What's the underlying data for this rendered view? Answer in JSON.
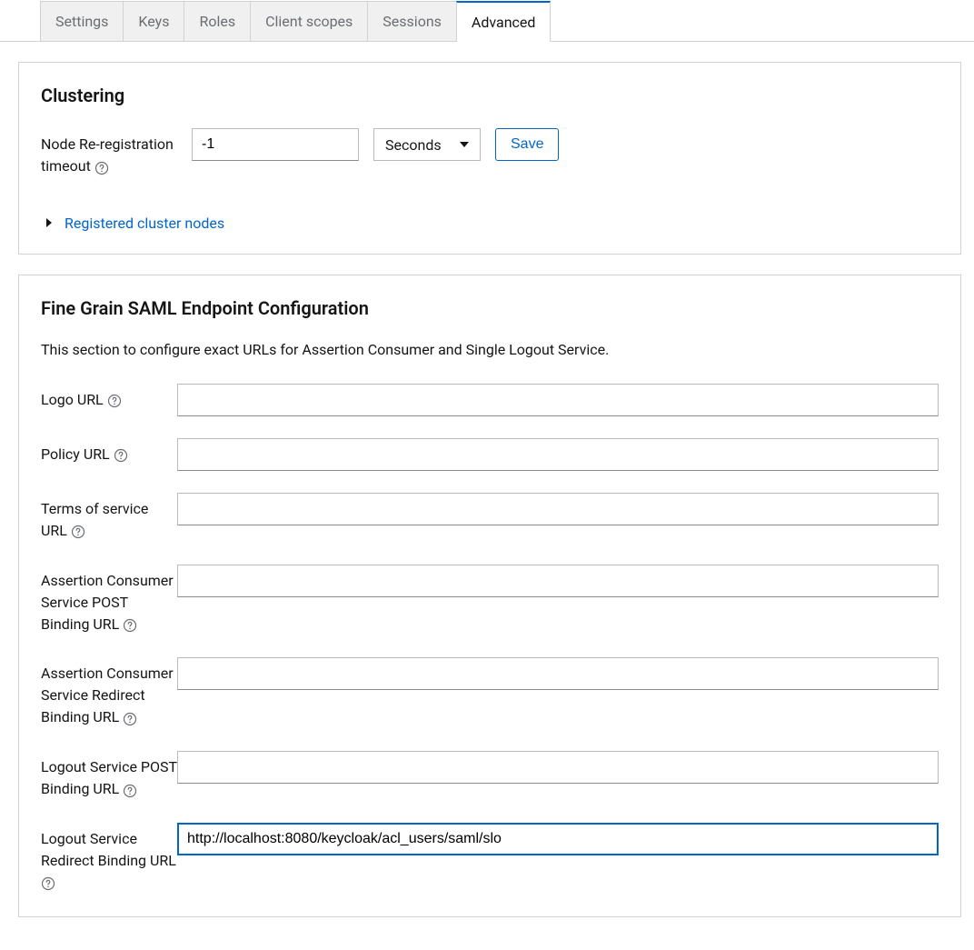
{
  "tabs": {
    "settings": "Settings",
    "keys": "Keys",
    "roles": "Roles",
    "client_scopes": "Client scopes",
    "sessions": "Sessions",
    "advanced": "Advanced"
  },
  "clustering": {
    "title": "Clustering",
    "node_rereg_label": "Node Re-registration timeout",
    "node_rereg_value": "-1",
    "unit_selected": "Seconds",
    "save_label": "Save",
    "expand_label": "Registered cluster nodes"
  },
  "saml": {
    "title": "Fine Grain SAML Endpoint Configuration",
    "description": "This section to configure exact URLs for Assertion Consumer and Single Logout Service.",
    "fields": {
      "logo_url": {
        "label": "Logo URL",
        "value": ""
      },
      "policy_url": {
        "label": "Policy URL",
        "value": ""
      },
      "tos_url": {
        "label": "Terms of service URL",
        "value": ""
      },
      "acs_post": {
        "label": "Assertion Consumer Service POST Binding URL",
        "value": ""
      },
      "acs_redirect": {
        "label": "Assertion Consumer Service Redirect Binding URL",
        "value": ""
      },
      "logout_post": {
        "label": "Logout Service POST Binding URL",
        "value": ""
      },
      "logout_redirect": {
        "label": "Logout Service Redirect Binding URL",
        "value": "http://localhost:8080/keycloak/acl_users/saml/slo"
      }
    }
  }
}
